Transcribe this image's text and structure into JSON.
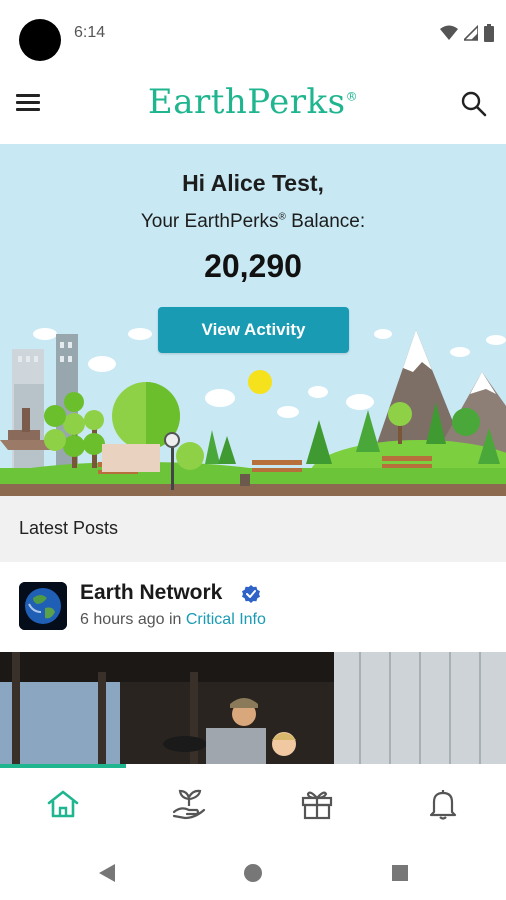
{
  "status_bar": {
    "time": "6:14"
  },
  "app_bar": {
    "brand": "EarthPerks",
    "brand_mark": "®",
    "icons": {
      "menu": "hamburger-menu-icon",
      "search": "search-icon"
    }
  },
  "hero": {
    "greeting": "Hi Alice Test,",
    "balance_label_prefix": "Your EarthPerks",
    "balance_label_mark": "®",
    "balance_label_suffix": " Balance:",
    "balance_value": "20,290",
    "button_label": "View Activity"
  },
  "latest": {
    "title": "Latest Posts"
  },
  "post": {
    "author": "Earth Network",
    "time_text": "6 hours ago in ",
    "category": "Critical Info"
  },
  "bottom_nav": {
    "items": [
      {
        "icon": "home-icon",
        "active": true
      },
      {
        "icon": "plant-in-hand-icon",
        "active": false
      },
      {
        "icon": "gift-icon",
        "active": false
      },
      {
        "icon": "bell-icon",
        "active": false
      }
    ]
  },
  "colors": {
    "brand": "#1fb58f",
    "accent": "#1a9bb4",
    "hero_bg": "#c8e8f3"
  }
}
